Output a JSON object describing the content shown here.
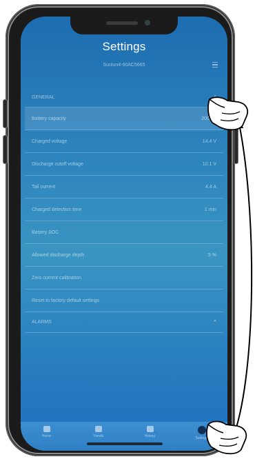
{
  "screen": {
    "title": "Settings",
    "device_name": "Sunlun4-60AC5665"
  },
  "list": {
    "general_header": "GENERAL",
    "rows": [
      {
        "label": "Battery capacity",
        "value": "200 Ah"
      },
      {
        "label": "Charged voltage",
        "value": "14.4 V"
      },
      {
        "label": "Discharge cutoff voltage",
        "value": "10.1 V"
      },
      {
        "label": "Tail current",
        "value": "4.4 A"
      },
      {
        "label": "Charged detection time",
        "value": "1 min"
      },
      {
        "label": "Battery SOC",
        "value": ""
      },
      {
        "label": "Allowed discharge depth",
        "value": "5 %"
      },
      {
        "label": "Zero current calibration",
        "value": ""
      },
      {
        "label": "Reset to factory default settings",
        "value": ""
      }
    ],
    "alarms_header": "ALARMS"
  },
  "nav": {
    "items": [
      {
        "label": "Home"
      },
      {
        "label": "Trends"
      },
      {
        "label": "History"
      },
      {
        "label": "Settings"
      }
    ]
  },
  "colors": {
    "screen_top": "#1d6db1",
    "screen_mid": "#3a95c2",
    "nav_bg": "#3c8fd0"
  }
}
